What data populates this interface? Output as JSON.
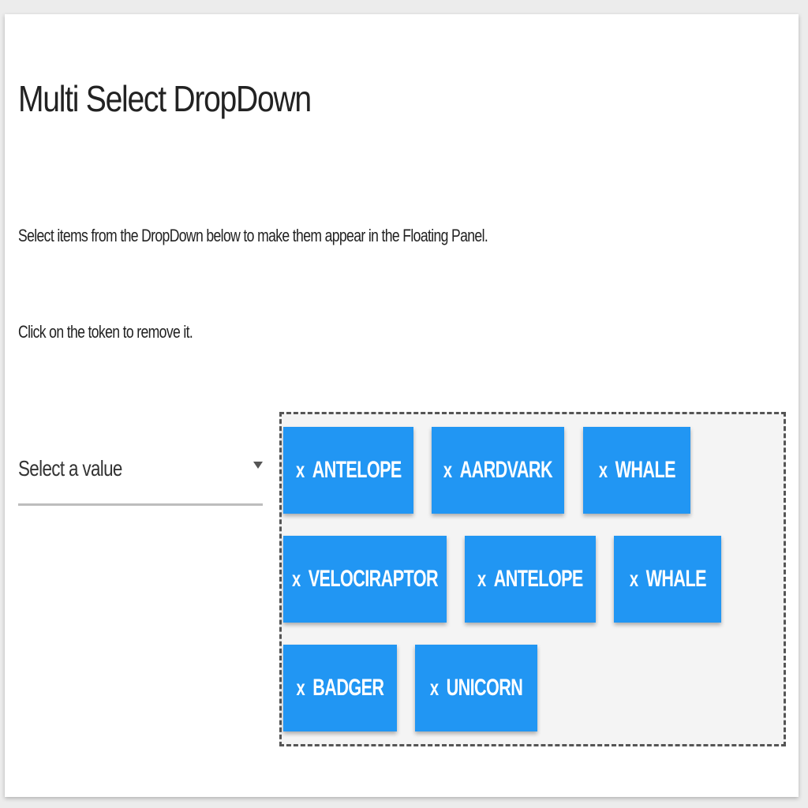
{
  "page": {
    "title": "Multi Select DropDown",
    "description": "Select items from the DropDown below to make them appear in the Floating Panel.",
    "hint": "Click on the token to remove it."
  },
  "dropdown": {
    "placeholder": "Select a value",
    "caret_icon": "caret-down-icon"
  },
  "floating_panel": {
    "remove_glyph": "x",
    "tokens": [
      {
        "label": "ANTELOPE"
      },
      {
        "label": "AARDVARK"
      },
      {
        "label": "WHALE"
      },
      {
        "label": "VELOCIRAPTOR"
      },
      {
        "label": "ANTELOPE"
      },
      {
        "label": "WHALE"
      },
      {
        "label": "BADGER"
      },
      {
        "label": "UNICORN"
      }
    ]
  },
  "colors": {
    "token_background": "#2196f3",
    "token_text": "#ffffff",
    "panel_background": "#f4f4f4",
    "panel_border": "#555555",
    "underline": "#bdbdbd"
  }
}
